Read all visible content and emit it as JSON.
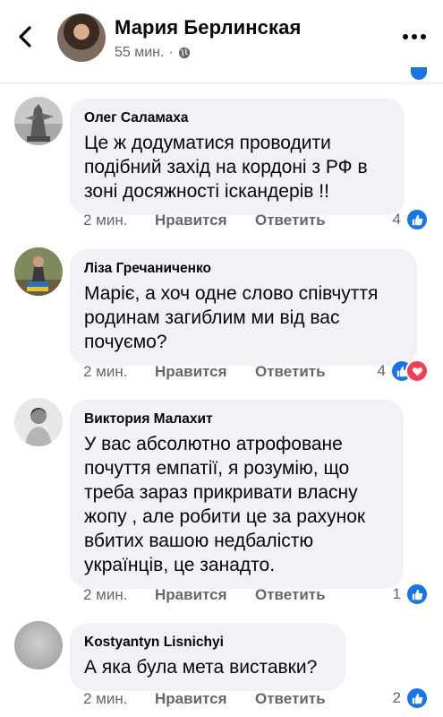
{
  "header": {
    "title": "Мария Берлинская",
    "time": "55 мин.",
    "separator": "·",
    "back_icon": "chevron-left-icon",
    "privacy_icon": "globe-icon",
    "menu_icon": "more-horizontal-icon"
  },
  "colors": {
    "accent": "#1b74e4",
    "love": "#f33e58",
    "bubble": "#f0f2f5",
    "secondary_text": "#65676b"
  },
  "comments": [
    {
      "author": "Олег Саламаха",
      "lines": [
        "Це ж додуматися проводити",
        "подібний захід на кордоні з РФ в",
        "зоні досяжності іскандерів !!"
      ],
      "time": "2 мин.",
      "like_label": "Нравится",
      "reply_label": "Ответить",
      "reaction_count": "4",
      "reactions": [
        "like"
      ]
    },
    {
      "author": "Ліза Гречаниченко",
      "lines": [
        "Маріє, а хоч одне слово співчуття",
        "родинам загиблим ми від вас",
        "почуємо?"
      ],
      "time": "2 мин.",
      "like_label": "Нравится",
      "reply_label": "Ответить",
      "reaction_count": "4",
      "reactions": [
        "like",
        "love"
      ]
    },
    {
      "author": "Виктория Малахит",
      "lines": [
        "У вас абсолютно атрофоване",
        "почуття емпатії, я розумію, що",
        "треба зараз прикривати власну",
        "жопу , але робити це за рахунок",
        "вбитих вашою недбалістю",
        "українців, це занадто."
      ],
      "time": "2 мин.",
      "like_label": "Нравится",
      "reply_label": "Ответить",
      "reaction_count": "1",
      "reactions": [
        "like"
      ]
    },
    {
      "author": "Kostyantyn Lisnichyi",
      "lines": [
        "А яка була мета виставки?"
      ],
      "time": "2 мин.",
      "like_label": "Нравится",
      "reply_label": "Ответить",
      "reaction_count": "2",
      "reactions": [
        "like"
      ]
    }
  ]
}
